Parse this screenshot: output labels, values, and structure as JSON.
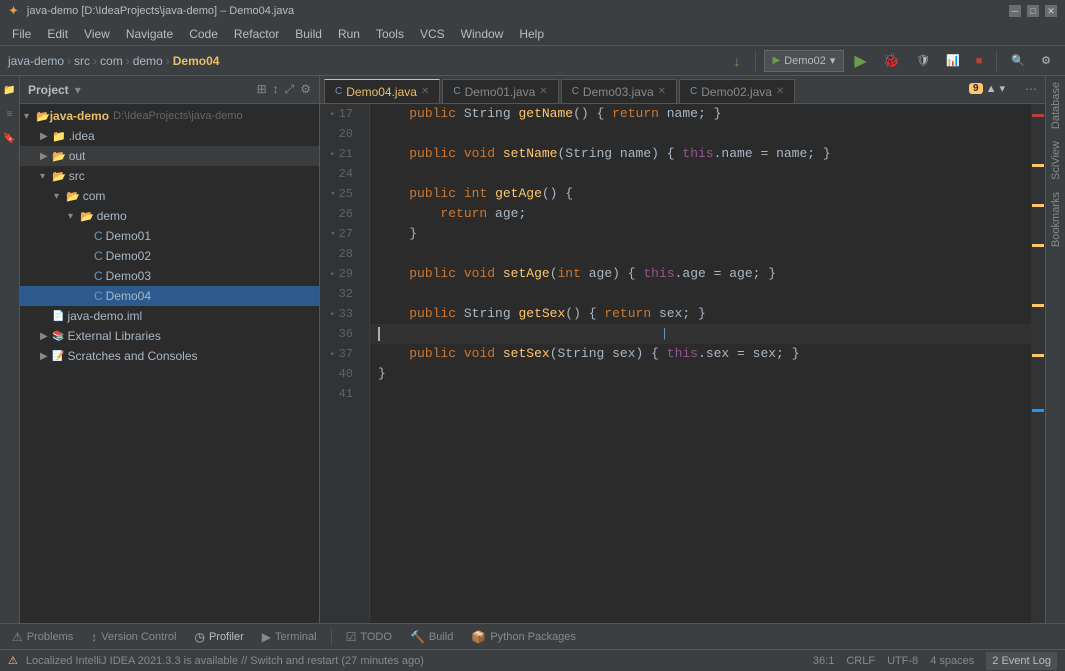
{
  "titleBar": {
    "title": "java-demo [D:\\IdeaProjects\\java-demo] – Demo04.java",
    "appName": "IntelliJ IDEA"
  },
  "menuBar": {
    "items": [
      "File",
      "Edit",
      "View",
      "Navigate",
      "Code",
      "Refactor",
      "Build",
      "Run",
      "Tools",
      "VCS",
      "Window",
      "Help"
    ]
  },
  "breadcrumb": {
    "items": [
      "java-demo",
      "src",
      "com",
      "demo",
      "Demo04"
    ]
  },
  "runConfig": {
    "label": "Demo02",
    "dropdown": "▾"
  },
  "projectPanel": {
    "title": "Project",
    "root": "java-demo",
    "rootPath": "D:\\IdeaProjects\\java-demo",
    "items": [
      {
        "label": ".idea",
        "type": "folder",
        "depth": 1,
        "collapsed": true
      },
      {
        "label": "out",
        "type": "folder",
        "depth": 1,
        "collapsed": true
      },
      {
        "label": "src",
        "type": "folder",
        "depth": 1,
        "expanded": true
      },
      {
        "label": "com",
        "type": "folder",
        "depth": 2,
        "expanded": true
      },
      {
        "label": "demo",
        "type": "folder",
        "depth": 3,
        "expanded": true
      },
      {
        "label": "Demo01",
        "type": "java",
        "depth": 4
      },
      {
        "label": "Demo02",
        "type": "java",
        "depth": 4
      },
      {
        "label": "Demo03",
        "type": "java",
        "depth": 4
      },
      {
        "label": "Demo04",
        "type": "java",
        "depth": 4,
        "selected": true
      },
      {
        "label": "java-demo.iml",
        "type": "iml",
        "depth": 1
      },
      {
        "label": "External Libraries",
        "type": "ext",
        "depth": 1,
        "collapsed": true
      },
      {
        "label": "Scratches and Consoles",
        "type": "scratches",
        "depth": 1,
        "collapsed": true
      }
    ]
  },
  "tabs": [
    {
      "label": "Demo04.java",
      "active": true
    },
    {
      "label": "Demo01.java",
      "active": false
    },
    {
      "label": "Demo03.java",
      "active": false
    },
    {
      "label": "Demo02.java",
      "active": false
    }
  ],
  "warnings": {
    "count": "9",
    "chevronUp": "▲",
    "chevronDown": "▾"
  },
  "codeLines": [
    {
      "num": 17,
      "content": "getName"
    },
    {
      "num": 20,
      "content": ""
    },
    {
      "num": 21,
      "content": "setName"
    },
    {
      "num": 24,
      "content": ""
    },
    {
      "num": 25,
      "content": "getAge"
    },
    {
      "num": 26,
      "content": "returnAge"
    },
    {
      "num": 27,
      "content": "closeGetAge"
    },
    {
      "num": 28,
      "content": ""
    },
    {
      "num": 29,
      "content": "setAge"
    },
    {
      "num": 32,
      "content": ""
    },
    {
      "num": 33,
      "content": "getSex"
    },
    {
      "num": 36,
      "content": "cursor",
      "current": true
    },
    {
      "num": 37,
      "content": "setSex"
    },
    {
      "num": 40,
      "content": "closeClass"
    },
    {
      "num": 41,
      "content": ""
    }
  ],
  "bottomTabs": [
    {
      "label": "Problems",
      "icon": "⚠"
    },
    {
      "label": "Version Control",
      "icon": "↕"
    },
    {
      "label": "Profiler",
      "icon": "◷"
    },
    {
      "label": "Terminal",
      "icon": "▶"
    },
    {
      "label": "TODO",
      "icon": "☑"
    },
    {
      "label": "Build",
      "icon": "🔨"
    },
    {
      "label": "Python Packages",
      "icon": "📦"
    }
  ],
  "statusBar": {
    "message": "Localized IntelliJ IDEA 2021.3.3 is available // Switch and restart (27 minutes ago)",
    "position": "36:1",
    "lineEnding": "CRLF",
    "encoding": "UTF-8",
    "indent": "4 spaces",
    "eventLog": "2 Event Log"
  },
  "rightPanels": [
    "Database",
    "SciView",
    "Bookmarks"
  ],
  "toolbar": {
    "searchIcon": "🔍",
    "settingsIcon": "⚙",
    "syncIcon": "↻"
  }
}
